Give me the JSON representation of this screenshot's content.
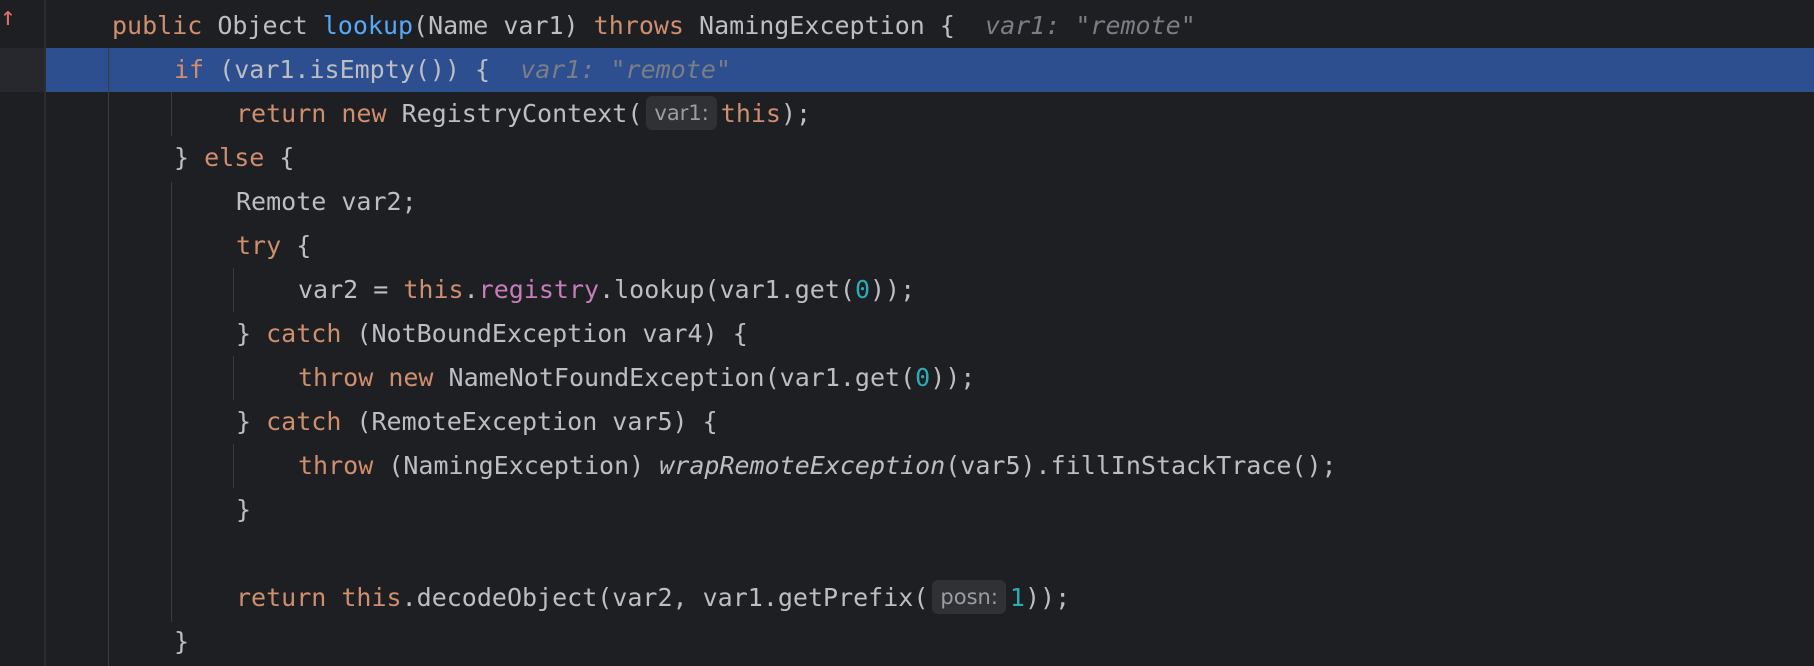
{
  "gutter": {
    "marker_icon": "up-arrow-icon",
    "marker_glyph": "↑"
  },
  "colors": {
    "background": "#1e1f22",
    "highlight": "#2e4f8f",
    "keyword": "#cf8e6d",
    "method": "#56a8f5",
    "field": "#c77dbb",
    "number": "#2aacb8",
    "text": "#bcbec4",
    "inlay": "#7a7e85"
  },
  "code": {
    "l1": {
      "kw_public": "public",
      "t1": " Object ",
      "method": "lookup",
      "t2": "(Name var1) ",
      "kw_throws": "throws",
      "t3": " NamingException {",
      "inlay": "var1: \"remote\""
    },
    "l2": {
      "kw_if": "if",
      "t1": " (var1.isEmpty()) {",
      "inlay": "var1: \"remote\""
    },
    "l3": {
      "kw_return": "return",
      "kw_new": "new",
      "t1": " RegistryContext(",
      "hint": "var1:",
      "kw_this": "this",
      "t2": ");"
    },
    "l4": {
      "t1": "} ",
      "kw_else": "else",
      "t2": " {"
    },
    "l5": {
      "t1": "Remote var2;"
    },
    "l6": {
      "kw_try": "try",
      "t1": " {"
    },
    "l7": {
      "t1": "var2 = ",
      "kw_this": "this",
      "t2": ".",
      "field": "registry",
      "t3": ".lookup(var1.get(",
      "num": "0",
      "t4": "));"
    },
    "l8": {
      "t1": "} ",
      "kw_catch": "catch",
      "t2": " (NotBoundException var4) {"
    },
    "l9": {
      "kw_throw": "throw",
      "kw_new": "new",
      "t1": " NameNotFoundException(var1.get(",
      "num": "0",
      "t2": "));"
    },
    "l10": {
      "t1": "} ",
      "kw_catch": "catch",
      "t2": " (RemoteException var5) {"
    },
    "l11": {
      "kw_throw": "throw",
      "t1": " (NamingException) ",
      "italic_method": "wrapRemoteException",
      "t2": "(var5).fillInStackTrace();"
    },
    "l12": {
      "t1": "}"
    },
    "l14": {
      "kw_return": "return",
      "kw_this": "this",
      "t1": ".decodeObject(var2, var1.getPrefix(",
      "hint": "posn:",
      "num": "1",
      "t2": "));"
    },
    "l15": {
      "t1": "}"
    }
  }
}
